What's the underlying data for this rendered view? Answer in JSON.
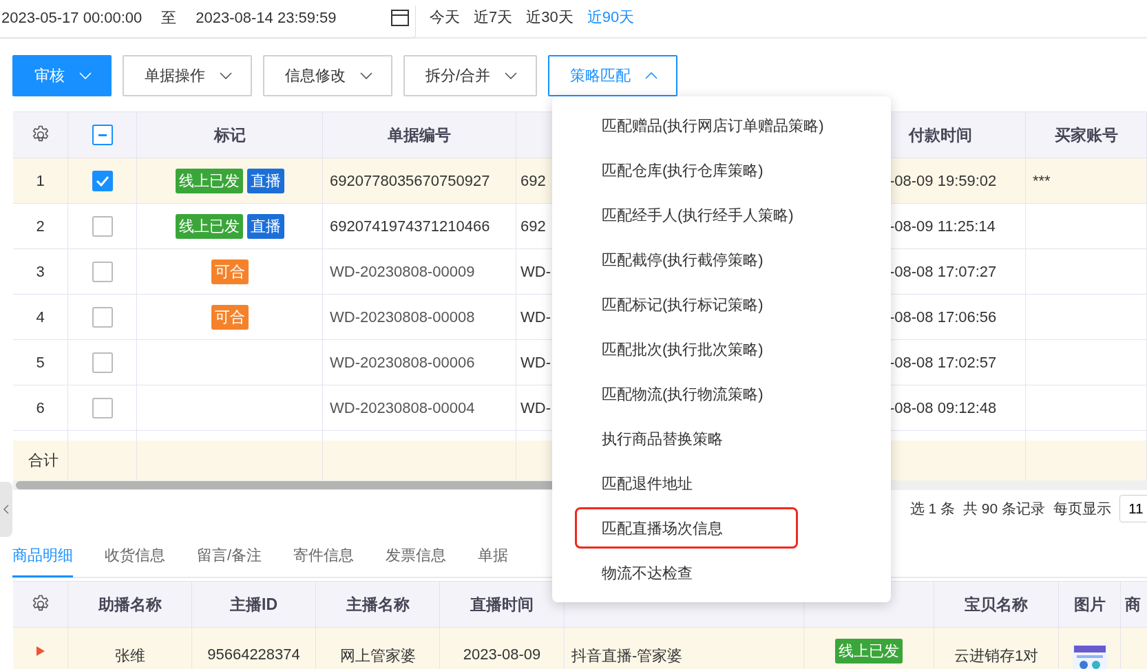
{
  "date_range": {
    "start": "2023-05-17 00:00:00",
    "separator": "至",
    "end": "2023-08-14 23:59:59"
  },
  "quick_ranges": [
    {
      "label": "今天",
      "selected": false
    },
    {
      "label": "近7天",
      "selected": false
    },
    {
      "label": "近30天",
      "selected": false
    },
    {
      "label": "近90天",
      "selected": true
    }
  ],
  "toolbar": [
    {
      "label": "审核",
      "kind": "primary",
      "expanded": false
    },
    {
      "label": "单据操作",
      "kind": "default",
      "expanded": false
    },
    {
      "label": "信息修改",
      "kind": "default",
      "expanded": false
    },
    {
      "label": "拆分/合并",
      "kind": "default",
      "expanded": false
    },
    {
      "label": "策略匹配",
      "kind": "default",
      "expanded": true
    }
  ],
  "dropdown": [
    {
      "label": "匹配赠品(执行网店订单赠品策略)",
      "highlighted": false
    },
    {
      "label": "匹配仓库(执行仓库策略)",
      "highlighted": false
    },
    {
      "label": "匹配经手人(执行经手人策略)",
      "highlighted": false
    },
    {
      "label": "匹配截停(执行截停策略)",
      "highlighted": false
    },
    {
      "label": "匹配标记(执行标记策略)",
      "highlighted": false
    },
    {
      "label": "匹配批次(执行批次策略)",
      "highlighted": false
    },
    {
      "label": "匹配物流(执行物流策略)",
      "highlighted": false
    },
    {
      "label": "执行商品替换策略",
      "highlighted": false
    },
    {
      "label": "匹配退件地址",
      "highlighted": false
    },
    {
      "label": "匹配直播场次信息",
      "highlighted": true
    },
    {
      "label": "物流不达检查",
      "highlighted": false
    }
  ],
  "table": {
    "header_indeterminate": true,
    "columns": [
      "标记",
      "单据编号",
      "",
      "付款时间",
      "买家账号"
    ],
    "rows": [
      {
        "index": "1",
        "selected": true,
        "checked": true,
        "tags": [
          {
            "label": "线上已发",
            "color": "#3aa63a"
          },
          {
            "label": "直播",
            "color": "#1c6fd8"
          }
        ],
        "number": "6920778035670750927",
        "column_5": "692",
        "paid": "-08-09 19:59:02",
        "buyer": "***"
      },
      {
        "index": "2",
        "selected": false,
        "checked": false,
        "tags": [
          {
            "label": "线上已发",
            "color": "#3aa63a"
          },
          {
            "label": "直播",
            "color": "#1c6fd8"
          }
        ],
        "number": "6920741974371210466",
        "column_5": "692",
        "paid": "-08-09 11:25:14",
        "buyer": ""
      },
      {
        "index": "3",
        "selected": false,
        "checked": false,
        "tags": [
          {
            "label": "可合",
            "color": "#f5822a"
          }
        ],
        "number": "WD-20230808-00009",
        "column_5": "WD-",
        "paid": "-08-08 17:07:27",
        "buyer": ""
      },
      {
        "index": "4",
        "selected": false,
        "checked": false,
        "tags": [
          {
            "label": "可合",
            "color": "#f5822a"
          }
        ],
        "number": "WD-20230808-00008",
        "column_5": "WD-",
        "paid": "-08-08 17:06:56",
        "buyer": ""
      },
      {
        "index": "5",
        "selected": false,
        "checked": false,
        "tags": [],
        "number": "WD-20230808-00006",
        "column_5": "WD-",
        "paid": "-08-08 17:02:57",
        "buyer": ""
      },
      {
        "index": "6",
        "selected": false,
        "checked": false,
        "tags": [],
        "number": "WD-20230808-00004",
        "column_5": "WD-",
        "paid": "-08-08 09:12:48",
        "buyer": ""
      }
    ],
    "summary_label": "合计"
  },
  "pagination": {
    "selected_text": "选 1 条",
    "total_text": "共 90 条记录",
    "page_size_label": "每页显示",
    "page_size": "11"
  },
  "detail_tabs": [
    {
      "label": "商品明细",
      "selected": true
    },
    {
      "label": "收货信息",
      "selected": false
    },
    {
      "label": "留言/备注",
      "selected": false
    },
    {
      "label": "寄件信息",
      "selected": false
    },
    {
      "label": "发票信息",
      "selected": false
    },
    {
      "label": "单据",
      "selected": false
    }
  ],
  "detail_table": {
    "columns": [
      "助播名称",
      "主播ID",
      "主播名称",
      "直播时间",
      "",
      "",
      "宝贝名称",
      "图片",
      "商"
    ],
    "rows": [
      {
        "cells": [
          "张维",
          "95664228374",
          "网上管家婆",
          "2023-08-09",
          "抖音直播-管家婆"
        ],
        "tag": {
          "label": "线上已发",
          "color": "#3aa63a"
        },
        "item_name": "云进销存1对",
        "image": {
          "kind": "picture"
        }
      }
    ]
  }
}
